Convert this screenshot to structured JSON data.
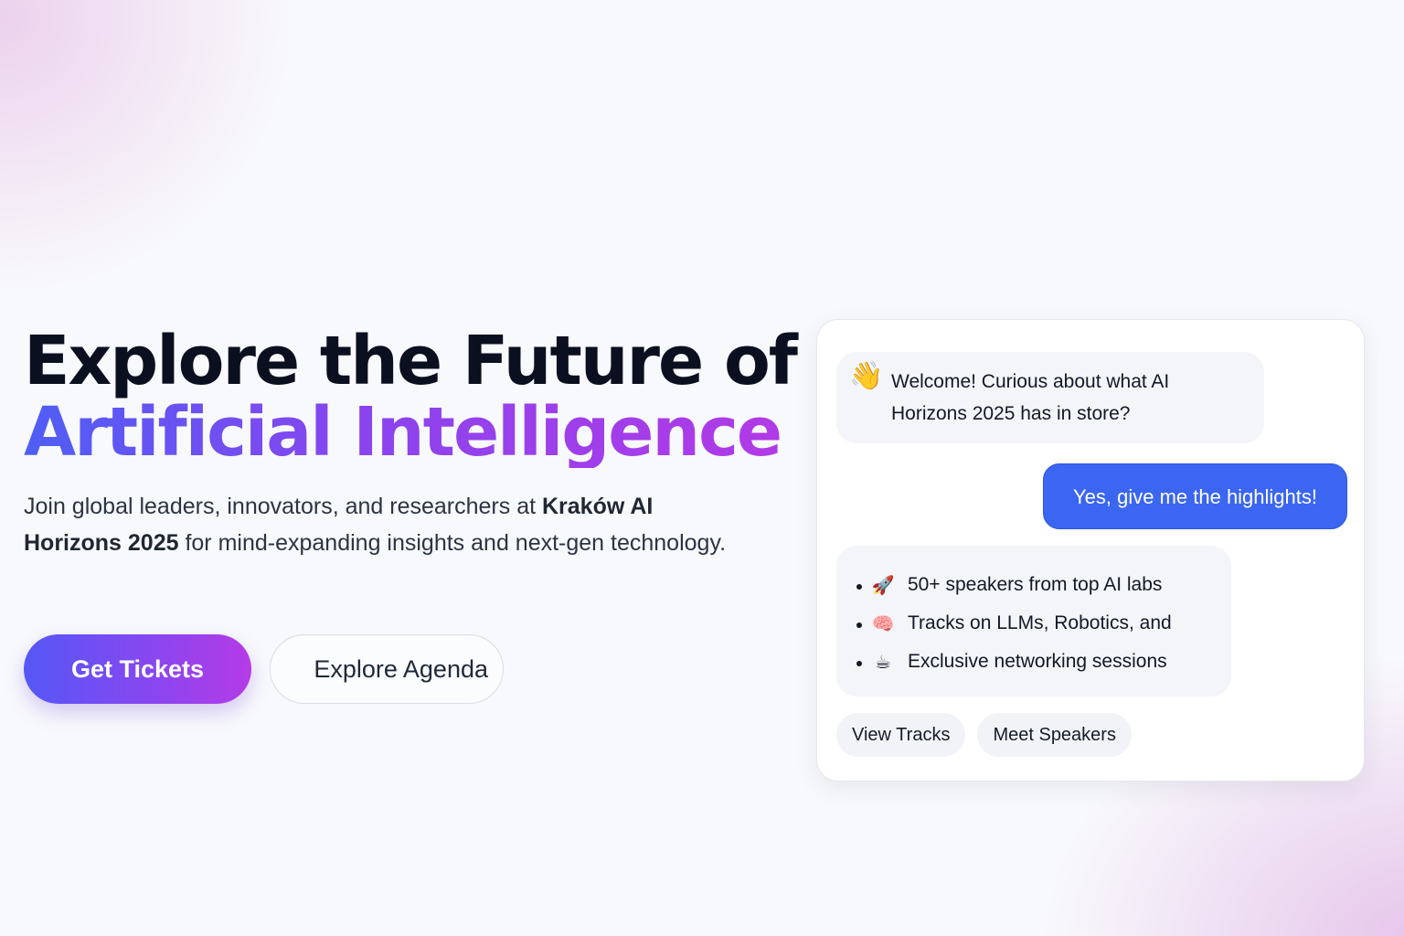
{
  "hero": {
    "headline_line1": "Explore the Future of",
    "headline_line2": "Artificial Intelligence",
    "lede_part1": "Join global leaders, innovators, and researchers at ",
    "lede_event": "Kraków AI Horizons 2025",
    "lede_part2": " for mind-expanding insights and next-gen technology."
  },
  "cta": {
    "primary_label": "Get Tickets",
    "secondary_label": "Explore Agenda"
  },
  "chat": {
    "welcome_icon": "waving-hand",
    "welcome_glyph": "👋",
    "welcome_text": "Welcome! Curious about what AI Horizons 2025 has in store?",
    "user_reply": "Yes, give me the highlights!",
    "highlights": [
      {
        "icon": "rocket",
        "glyph": "🚀",
        "text": "50+ speakers from top AI labs"
      },
      {
        "icon": "brain",
        "glyph": "🧠",
        "text": "Tracks on LLMs, Robotics, and"
      },
      {
        "icon": "coffee",
        "glyph": "☕",
        "text": "Exclusive networking sessions"
      }
    ],
    "quick_replies": [
      "View Tracks",
      "Meet Speakers"
    ]
  },
  "colors": {
    "accent_gradient_start": "#4f5ef5",
    "accent_gradient_end": "#b13ae6",
    "user_bubble": "#3b66f1",
    "bot_bubble": "#f4f5f9"
  }
}
